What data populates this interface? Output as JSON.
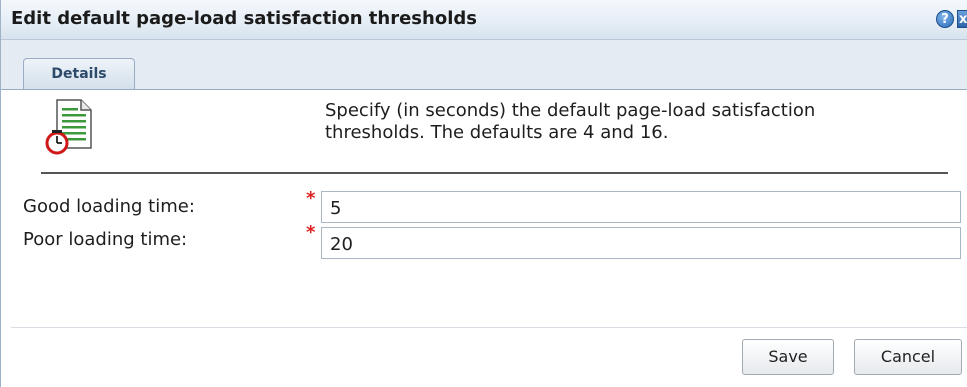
{
  "dialog": {
    "title": "Edit default page-load satisfaction thresholds",
    "help_icon": "?",
    "close_icon": "x"
  },
  "tabs": [
    {
      "label": "Details",
      "selected": true
    }
  ],
  "description": {
    "line1": "Specify (in seconds) the default page-load satisfaction",
    "line2": "thresholds. The defaults are 4 and 16."
  },
  "fields": {
    "good": {
      "label": "Good loading time:",
      "required_mark": "*",
      "value": "5"
    },
    "poor": {
      "label": "Poor loading time:",
      "required_mark": "*",
      "value": "20"
    }
  },
  "buttons": {
    "save": "Save",
    "cancel": "Cancel"
  },
  "colors": {
    "required": "#e02020",
    "accent": "#2a6bb8"
  }
}
